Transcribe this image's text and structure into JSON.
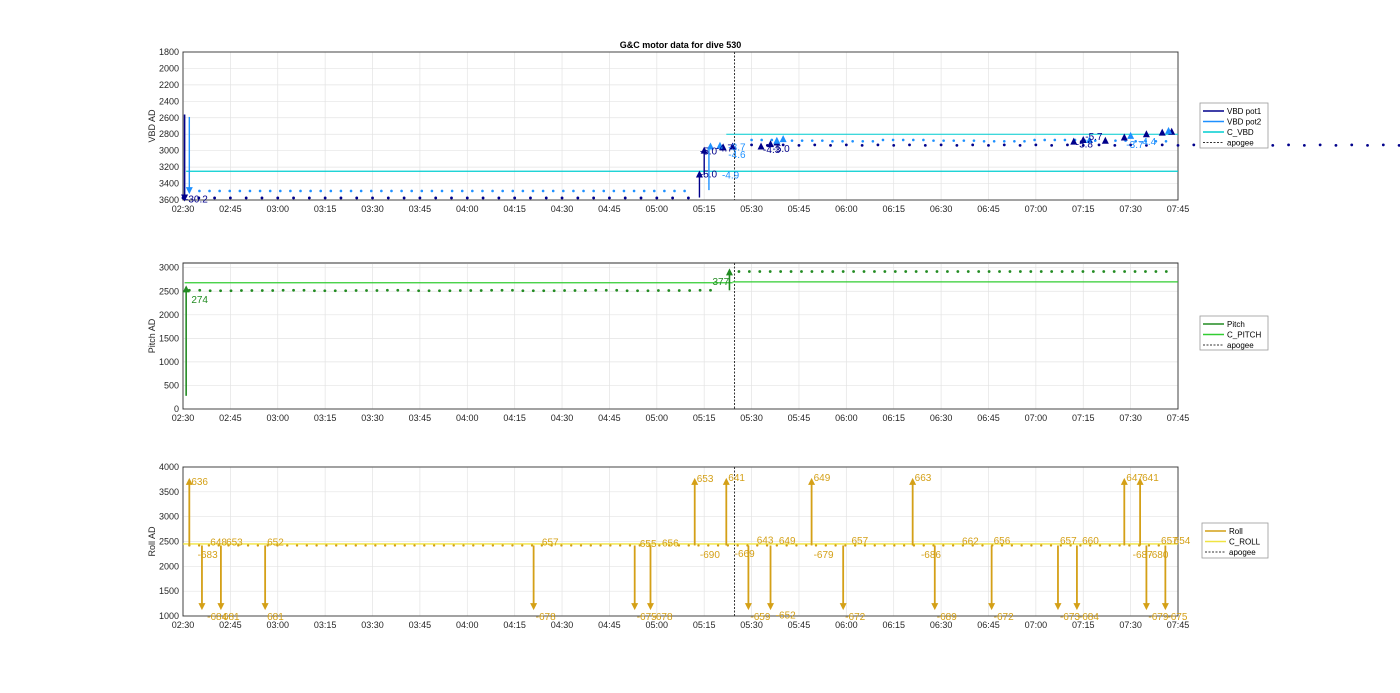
{
  "chart_data": [
    {
      "type": "line",
      "title": "G&C motor data for dive 530",
      "ylabel": "VBD AD",
      "ylim": [
        1800,
        3600
      ],
      "y_reversed": true,
      "yticks": [
        "1800",
        "2000",
        "2200",
        "2400",
        "2600",
        "2800",
        "3000",
        "3200",
        "3400",
        "3600"
      ],
      "xticks": [
        "02:30",
        "02:45",
        "03:00",
        "03:15",
        "03:30",
        "03:45",
        "04:00",
        "04:15",
        "04:30",
        "04:45",
        "05:00",
        "05:15",
        "05:30",
        "05:45",
        "06:00",
        "06:15",
        "06:30",
        "06:45",
        "07:00",
        "07:15",
        "07:30",
        "07:45"
      ],
      "grid": true,
      "legend_position": "outside-right",
      "legend": [
        "VBD pot1",
        "VBD pot2",
        "C_VBD",
        "apogee"
      ],
      "colors": {
        "pot1": "#00008b",
        "pot2": "#1e90ff",
        "cvbd": "#00ced1",
        "apogee": "#333333",
        "ann_dark": "#00008b",
        "ann_light": "#1e90ff"
      },
      "series": [
        {
          "name": "VBD pot1",
          "x_minutes": [
            0,
            5,
            10,
            15,
            20,
            25,
            30,
            35,
            40,
            45,
            50,
            55,
            60,
            65,
            70,
            75,
            80,
            85,
            90,
            95,
            100,
            105,
            110,
            115,
            120,
            125,
            130,
            135,
            140,
            145,
            150,
            155,
            160,
            165,
            170,
            175,
            180,
            185,
            190,
            195,
            200,
            205,
            210,
            215,
            220,
            225,
            230,
            235,
            240,
            245,
            250,
            255,
            260,
            265,
            270,
            275,
            280,
            285,
            290,
            295,
            300,
            305,
            310,
            315,
            320,
            325,
            330,
            335,
            340,
            345,
            350,
            355,
            360,
            365,
            370,
            375,
            380,
            385,
            390,
            395,
            400,
            405,
            410,
            415,
            420,
            425,
            430,
            435,
            440,
            445,
            450,
            455,
            460,
            465,
            470,
            475
          ],
          "y": [
            3575,
            3575,
            3575,
            3575,
            3575,
            3575,
            3575,
            3575,
            3575,
            3575,
            3575,
            3575,
            3575,
            3575,
            3575,
            3575,
            3575,
            3575,
            3575,
            3575,
            3575,
            3575,
            3575,
            3575,
            3575,
            3575,
            3575,
            3575,
            3575,
            3575,
            3575,
            3575,
            3575,
            3575,
            3575,
            3575,
            3575,
            3575,
            3575,
            3575,
            3575,
            3575,
            3575,
            3575,
            3575,
            3575,
            3575,
            3575,
            3575,
            3575,
            3575,
            3575,
            3575,
            3575,
            3575,
            3575,
            3575,
            3575,
            3575,
            3575,
            3575,
            3575,
            3575,
            3575,
            3575,
            3575,
            3575,
            3575,
            3575,
            3575,
            3575,
            3575,
            3575,
            3575,
            3575,
            3575,
            3575,
            3575,
            3575,
            3575,
            3575,
            3575,
            3575,
            3575,
            3575,
            3575,
            3575,
            3575,
            3575,
            3575,
            3575,
            3575,
            3575,
            3575,
            3575,
            3575
          ]
        },
        {
          "name": "VBD pot2",
          "y_level_before": 3490,
          "y_level_after": 2880
        },
        {
          "name": "C_VBD",
          "y": 3250
        }
      ],
      "annotations": [
        {
          "text": "-30.2",
          "x_minutes": 0,
          "y": 3580
        },
        {
          "text": "-5.0",
          "x_minutes": 163,
          "y": 3000
        },
        {
          "text": "-5.0",
          "x_minutes": 163,
          "y": 3280
        },
        {
          "text": "-4.7",
          "x_minutes": 168,
          "y": 2960
        },
        {
          "text": "-3.7",
          "x_minutes": 172,
          "y": 2950
        },
        {
          "text": "-4.6",
          "x_minutes": 172,
          "y": 3040
        },
        {
          "text": "-4.9",
          "x_minutes": 170,
          "y": 3290
        },
        {
          "text": "-4.3",
          "x_minutes": 183,
          "y": 2980
        },
        {
          "text": "-5.0",
          "x_minutes": 186,
          "y": 2970
        },
        {
          "text": "-5.7",
          "x_minutes": 285,
          "y": 2820
        },
        {
          "text": "-5.8",
          "x_minutes": 282,
          "y": 2910
        },
        {
          "text": "-3.7",
          "x_minutes": 298,
          "y": 2920
        },
        {
          "text": "-4.4",
          "x_minutes": 302,
          "y": 2880
        }
      ]
    },
    {
      "type": "line",
      "ylabel": "Pitch AD",
      "ylim": [
        0,
        3100
      ],
      "yticks": [
        "0",
        "500",
        "1000",
        "1500",
        "2000",
        "2500",
        "3000"
      ],
      "xticks": [
        "02:30",
        "02:45",
        "03:00",
        "03:15",
        "03:30",
        "03:45",
        "04:00",
        "04:15",
        "04:30",
        "04:45",
        "05:00",
        "05:15",
        "05:30",
        "05:45",
        "06:00",
        "06:15",
        "06:30",
        "06:45",
        "07:00",
        "07:15",
        "07:30",
        "07:45"
      ],
      "grid": true,
      "legend_position": "outside-right",
      "legend": [
        "Pitch",
        "C_PITCH",
        "apogee"
      ],
      "colors": {
        "pitch": "#228b22",
        "cpitch": "#32cd32",
        "apogee": "#333333"
      },
      "series": [
        {
          "name": "Pitch",
          "y_level_before": 2520,
          "y_level_after": 2920
        },
        {
          "name": "C_PITCH",
          "y_before": 2680,
          "y_after": 2700
        }
      ],
      "annotations": [
        {
          "text": "274",
          "x_minutes": 2,
          "y": 2340
        },
        {
          "text": "377",
          "x_minutes": 167,
          "y": 2720
        }
      ]
    },
    {
      "type": "line",
      "ylabel": "Roll AD",
      "ylim": [
        1000,
        4000
      ],
      "yticks": [
        "1000",
        "1500",
        "2000",
        "2500",
        "3000",
        "3500",
        "4000"
      ],
      "xticks": [
        "02:30",
        "02:45",
        "03:00",
        "03:15",
        "03:30",
        "03:45",
        "04:00",
        "04:15",
        "04:30",
        "04:45",
        "05:00",
        "05:15",
        "05:30",
        "05:45",
        "06:00",
        "06:15",
        "06:30",
        "06:45",
        "07:00",
        "07:15",
        "07:30",
        "07:45"
      ],
      "grid": true,
      "legend_position": "outside-right",
      "legend": [
        "Roll",
        "C_ROLL",
        "apogee"
      ],
      "colors": {
        "roll": "#d4a017",
        "croll": "#f0e442",
        "apogee": "#333333"
      },
      "series": [
        {
          "name": "Roll",
          "y_level": 2420
        },
        {
          "name": "C_ROLL",
          "y": 2450
        }
      ],
      "annotations": [
        {
          "text": "636",
          "x_minutes": 2,
          "y": 3720
        },
        {
          "text": "-683",
          "x_minutes": 4,
          "y": 2250
        },
        {
          "text": "648",
          "x_minutes": 8,
          "y": 2500
        },
        {
          "text": "653",
          "x_minutes": 13,
          "y": 2500
        },
        {
          "text": "-684",
          "x_minutes": 7,
          "y": 1000
        },
        {
          "text": "681",
          "x_minutes": 12,
          "y": 1000
        },
        {
          "text": "652",
          "x_minutes": 26,
          "y": 2500
        },
        {
          "text": "681",
          "x_minutes": 26,
          "y": 1000
        },
        {
          "text": "657",
          "x_minutes": 113,
          "y": 2500
        },
        {
          "text": "-678",
          "x_minutes": 111,
          "y": 1000
        },
        {
          "text": "655",
          "x_minutes": 144,
          "y": 2470
        },
        {
          "text": "656",
          "x_minutes": 151,
          "y": 2480
        },
        {
          "text": "-675",
          "x_minutes": 143,
          "y": 1000
        },
        {
          "text": "-678",
          "x_minutes": 148,
          "y": 1000
        },
        {
          "text": "653",
          "x_minutes": 162,
          "y": 3780
        },
        {
          "text": "-690",
          "x_minutes": 163,
          "y": 2250
        },
        {
          "text": "641",
          "x_minutes": 172,
          "y": 3800
        },
        {
          "text": "-669",
          "x_minutes": 174,
          "y": 2270
        },
        {
          "text": "643",
          "x_minutes": 181,
          "y": 2540
        },
        {
          "text": "649",
          "x_minutes": 188,
          "y": 2530
        },
        {
          "text": "-659",
          "x_minutes": 179,
          "y": 1000
        },
        {
          "text": "-652",
          "x_minutes": 187,
          "y": 1030
        },
        {
          "text": "649",
          "x_minutes": 199,
          "y": 3800
        },
        {
          "text": "-679",
          "x_minutes": 199,
          "y": 2250
        },
        {
          "text": "657",
          "x_minutes": 211,
          "y": 2530
        },
        {
          "text": "-672",
          "x_minutes": 209,
          "y": 1000
        },
        {
          "text": "663",
          "x_minutes": 231,
          "y": 3800
        },
        {
          "text": "-686",
          "x_minutes": 233,
          "y": 2250
        },
        {
          "text": "-689",
          "x_minutes": 238,
          "y": 1000
        },
        {
          "text": "662",
          "x_minutes": 246,
          "y": 2520
        },
        {
          "text": "656",
          "x_minutes": 256,
          "y": 2530
        },
        {
          "text": "-672",
          "x_minutes": 256,
          "y": 1000
        },
        {
          "text": "657",
          "x_minutes": 277,
          "y": 2530
        },
        {
          "text": "660",
          "x_minutes": 284,
          "y": 2530
        },
        {
          "text": "-673",
          "x_minutes": 277,
          "y": 1000
        },
        {
          "text": "-684",
          "x_minutes": 283,
          "y": 1000
        },
        {
          "text": "647",
          "x_minutes": 298,
          "y": 3800
        },
        {
          "text": "641",
          "x_minutes": 303,
          "y": 3800
        },
        {
          "text": "-687",
          "x_minutes": 300,
          "y": 2250
        },
        {
          "text": "-680",
          "x_minutes": 305,
          "y": 2250
        },
        {
          "text": "657",
          "x_minutes": 309,
          "y": 2530
        },
        {
          "text": "654",
          "x_minutes": 313,
          "y": 2530
        },
        {
          "text": "-679",
          "x_minutes": 305,
          "y": 1000
        },
        {
          "text": "-675",
          "x_minutes": 311,
          "y": 1000
        }
      ]
    }
  ]
}
